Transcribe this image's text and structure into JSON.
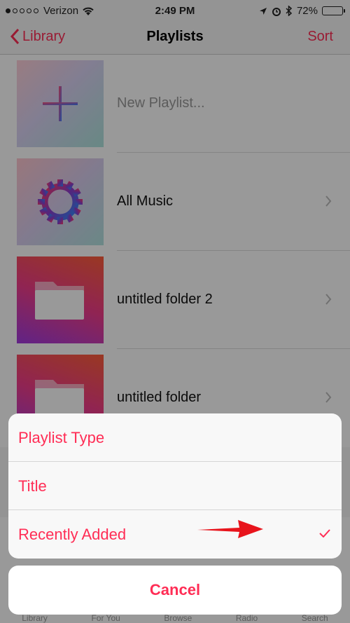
{
  "status": {
    "carrier": "Verizon",
    "time": "2:49 PM",
    "battery": "72%",
    "battery_level": 0.72
  },
  "nav": {
    "back_label": "Library",
    "title": "Playlists",
    "sort_label": "Sort"
  },
  "playlists": [
    {
      "label": "New Playlist...",
      "icon": "plus-icon"
    },
    {
      "label": "All Music",
      "icon": "gear-icon"
    },
    {
      "label": "untitled folder 2",
      "icon": "folder-icon"
    },
    {
      "label": "untitled folder",
      "icon": "folder-icon"
    }
  ],
  "sort_sheet": {
    "options": [
      {
        "label": "Playlist Type",
        "selected": false
      },
      {
        "label": "Title",
        "selected": false
      },
      {
        "label": "Recently Added",
        "selected": true
      }
    ],
    "cancel_label": "Cancel"
  },
  "tabs": [
    "Library",
    "For You",
    "Browse",
    "Radio",
    "Search"
  ],
  "colors": {
    "accent": "#ff2d55",
    "annotation_arrow": "#e8141c"
  }
}
